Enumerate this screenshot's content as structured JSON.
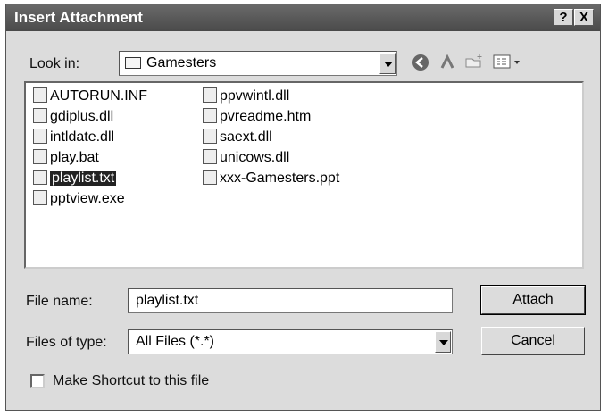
{
  "window": {
    "title": "Insert Attachment",
    "help_label": "?",
    "close_label": "X"
  },
  "lookin": {
    "label": "Look in:",
    "value": "Gamesters"
  },
  "toolbar": {
    "back_icon": "back-arrow-icon",
    "up_icon": "up-folder-icon",
    "newfolder_icon": "new-folder-icon",
    "views_icon": "view-menu-icon"
  },
  "files": [
    {
      "name": "AUTORUN.INF",
      "icon": "setup-info-icon"
    },
    {
      "name": "gdiplus.dll",
      "icon": "dll-icon"
    },
    {
      "name": "intldate.dll",
      "icon": "dll-icon"
    },
    {
      "name": "play.bat",
      "icon": "batch-icon"
    },
    {
      "name": "playlist.txt",
      "icon": "text-file-icon",
      "selected": true
    },
    {
      "name": "pptview.exe",
      "icon": "exe-icon"
    },
    {
      "name": "ppvwintl.dll",
      "icon": "dll-icon"
    },
    {
      "name": "pvreadme.htm",
      "icon": "html-icon"
    },
    {
      "name": "saext.dll",
      "icon": "dll-icon"
    },
    {
      "name": "unicows.dll",
      "icon": "dll-icon"
    },
    {
      "name": "xxx-Gamesters.ppt",
      "icon": "ppt-icon"
    }
  ],
  "filename": {
    "label": "File name:",
    "value": "playlist.txt"
  },
  "filetype": {
    "label": "Files of type:",
    "value": "All Files (*.*)"
  },
  "buttons": {
    "attach": "Attach",
    "cancel": "Cancel"
  },
  "shortcut": {
    "label": "Make Shortcut to this file",
    "checked": false
  }
}
